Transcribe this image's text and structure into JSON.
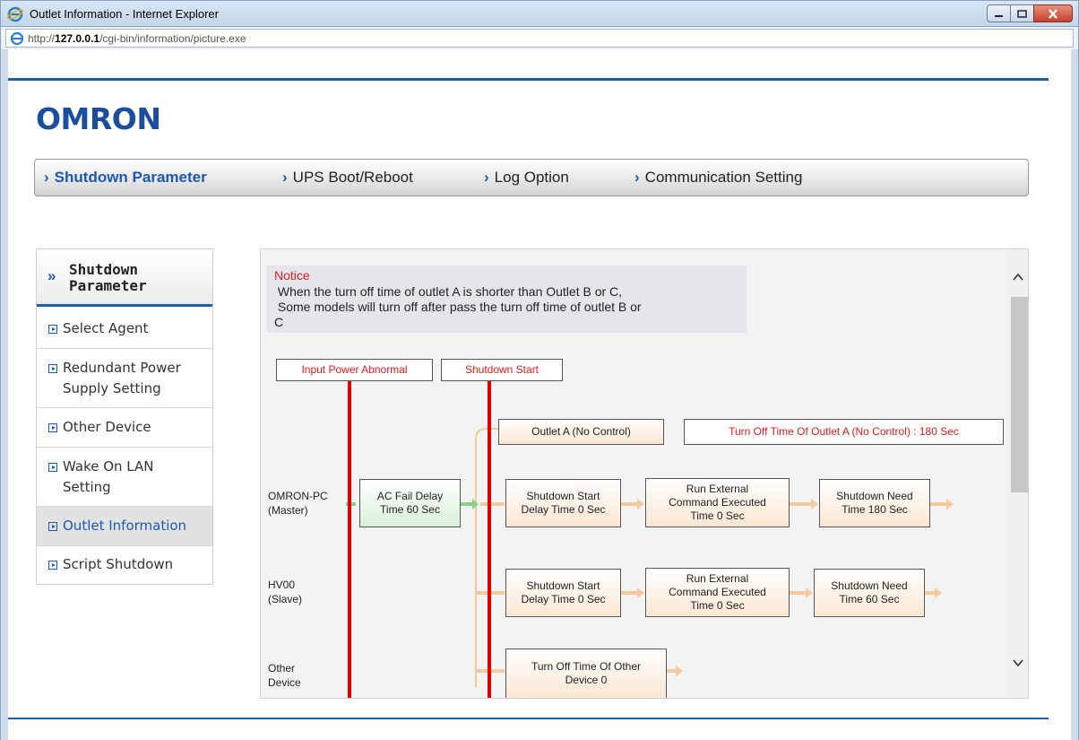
{
  "window": {
    "title": "Outlet Information - Internet Explorer",
    "url_prefix": "http://",
    "url_host": "127.0.0.1",
    "url_path": "/cgi-bin/information/picture.exe"
  },
  "brand": {
    "logo_text": "OMRON",
    "color": "#1b4f9e"
  },
  "topnav": {
    "items": [
      {
        "label": "Shutdown Parameter",
        "active": true
      },
      {
        "label": "UPS Boot/Reboot",
        "active": false
      },
      {
        "label": "Log Option",
        "active": false
      },
      {
        "label": "Communication Setting",
        "active": false
      }
    ]
  },
  "sidebar": {
    "heading_line1": "Shutdown",
    "heading_line2": "Parameter",
    "items": [
      {
        "label": "Select Agent"
      },
      {
        "label": "Redundant Power Supply Setting"
      },
      {
        "label": "Other Device"
      },
      {
        "label": "Wake On LAN Setting"
      },
      {
        "label": "Outlet Information",
        "active": true
      },
      {
        "label": "Script Shutdown"
      }
    ]
  },
  "notice": {
    "title": "Notice",
    "body": " When the turn off time of outlet A is shorter than Outlet B or C,\n Some models will turn off after pass the turn off time of outlet B or\nC"
  },
  "diagram": {
    "input_power_abnormal": "Input Power Abnormal",
    "shutdown_start": "Shutdown Start",
    "outlet_a": "Outlet A (No Control)",
    "outlet_a_time": "Turn Off Time Of Outlet A (No Control) : 180 Sec",
    "master_name": "OMRON-PC",
    "master_role": "(Master)",
    "ac_fail_line1": "AC Fail Delay",
    "ac_fail_line2": "Time 60 Sec",
    "master_sd_start_1": "Shutdown Start",
    "master_sd_start_2": "Delay Time 0 Sec",
    "master_run_1": "Run External",
    "master_run_2": "Command Executed",
    "master_run_3": "Time 0 Sec",
    "master_need_1": "Shutdown Need",
    "master_need_2": "Time 180 Sec",
    "slave_name": "HV00",
    "slave_role": "(Slave)",
    "slave_sd_start_1": "Shutdown Start",
    "slave_sd_start_2": "Delay Time 0 Sec",
    "slave_run_1": "Run External",
    "slave_run_2": "Command Executed",
    "slave_run_3": "Time 0 Sec",
    "slave_need_1": "Shutdown Need",
    "slave_need_2": "Time 60 Sec",
    "other_name_1": "Other",
    "other_name_2": "Device",
    "other_time_1": "Turn Off Time Of Other",
    "other_time_2": "Device 0"
  },
  "colors": {
    "accent_blue": "#1f5ea8",
    "alert_red": "#e00000",
    "arrow_orange": "#f3c99d",
    "arrow_green": "#8bcf8b"
  }
}
